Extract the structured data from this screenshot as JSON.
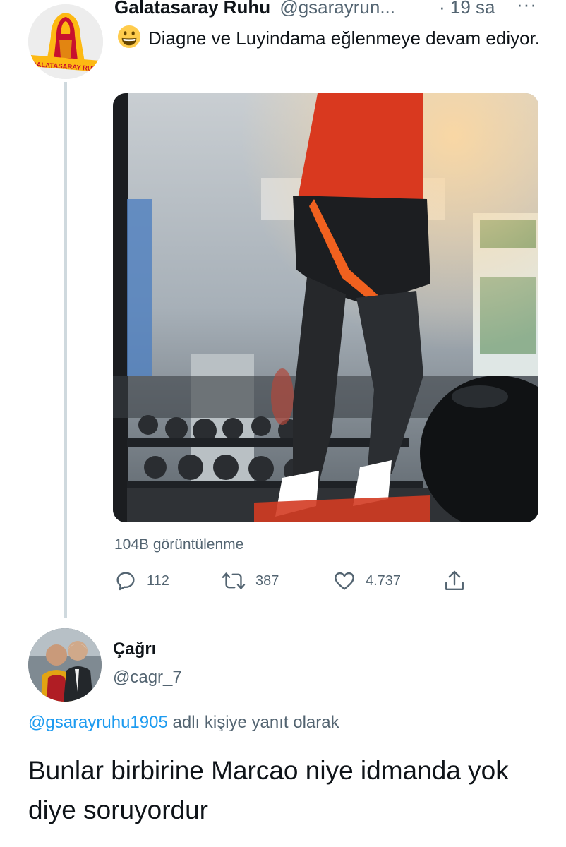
{
  "parent_tweet": {
    "author_name": "Galatasaray Ruhu",
    "handle": "@gsarayrun...",
    "time": "· 19 sa",
    "more_label": "···",
    "avatar_text": "GALATASARAY RUH",
    "emoji": "grinning-face-emoji",
    "text": "Diagne ve Luyindama eğlenmeye devam ediyor.",
    "views": "104B görüntülenme",
    "stats": {
      "replies": "112",
      "retweets": "387",
      "likes": "4.737"
    }
  },
  "reply_tweet": {
    "author_name": "Çağrı",
    "handle": "@cagr_7",
    "replying_to_mention": "@gsarayruhu1905",
    "replying_to_suffix": " adlı kişiye yanıt olarak",
    "text": "Bunlar birbirine Marcao niye idmanda yok diye soruyordur"
  },
  "colors": {
    "text_primary": "#0f1419",
    "text_secondary": "#536471",
    "link": "#1d9bf0",
    "thread_line": "#cfd9de",
    "brand_red": "#c8102e",
    "brand_yellow": "#fdb913"
  },
  "icons": [
    "reply-icon",
    "retweet-icon",
    "like-icon",
    "share-icon",
    "more-icon"
  ]
}
